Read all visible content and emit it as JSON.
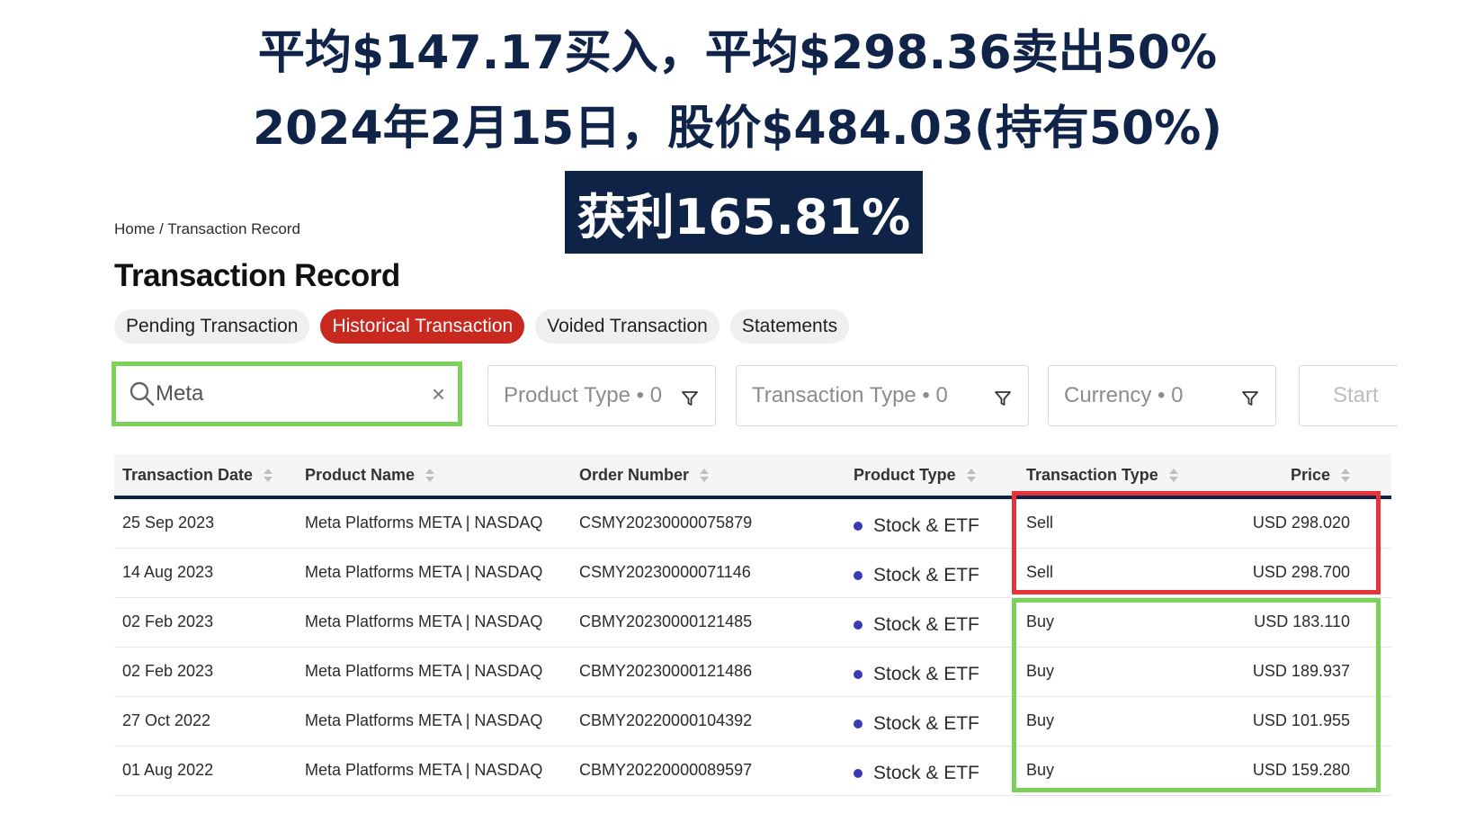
{
  "headline": {
    "line1": "平均$147.17买入，平均$298.36卖出50%",
    "line2": "2024年2月15日，股价$484.03(持有50%)",
    "profit": "获利165.81%"
  },
  "breadcrumb": "Home / Transaction Record",
  "page_title": "Transaction Record",
  "tabs": [
    {
      "label": "Pending Transaction",
      "active": false
    },
    {
      "label": "Historical Transaction",
      "active": true
    },
    {
      "label": "Voided Transaction",
      "active": false
    },
    {
      "label": "Statements",
      "active": false
    }
  ],
  "search": {
    "value": "Meta",
    "clear_symbol": "×"
  },
  "filters": {
    "product_type": "Product Type • 0",
    "transaction_type": "Transaction Type • 0",
    "currency": "Currency • 0",
    "start": "Start"
  },
  "table": {
    "headers": {
      "date": "Transaction Date",
      "product_name": "Product Name",
      "order_number": "Order Number",
      "product_type": "Product Type",
      "transaction_type": "Transaction Type",
      "price": "Price"
    },
    "rows": [
      {
        "date": "25 Sep 2023",
        "name": "Meta Platforms META | NASDAQ",
        "order": "CSMY20230000075879",
        "ptype": "Stock & ETF",
        "ttype": "Sell",
        "price": "USD 298.020"
      },
      {
        "date": "14 Aug 2023",
        "name": "Meta Platforms META | NASDAQ",
        "order": "CSMY20230000071146",
        "ptype": "Stock & ETF",
        "ttype": "Sell",
        "price": "USD 298.700"
      },
      {
        "date": "02 Feb 2023",
        "name": "Meta Platforms META | NASDAQ",
        "order": "CBMY20230000121485",
        "ptype": "Stock & ETF",
        "ttype": "Buy",
        "price": "USD 183.110"
      },
      {
        "date": "02 Feb 2023",
        "name": "Meta Platforms META | NASDAQ",
        "order": "CBMY20230000121486",
        "ptype": "Stock & ETF",
        "ttype": "Buy",
        "price": "USD 189.937"
      },
      {
        "date": "27 Oct 2022",
        "name": "Meta Platforms META | NASDAQ",
        "order": "CBMY20220000104392",
        "ptype": "Stock & ETF",
        "ttype": "Buy",
        "price": "USD 101.955"
      },
      {
        "date": "01 Aug 2022",
        "name": "Meta Platforms META | NASDAQ",
        "order": "CBMY20220000089597",
        "ptype": "Stock & ETF",
        "ttype": "Buy",
        "price": "USD 159.280"
      }
    ]
  },
  "colors": {
    "headline": "#10244a",
    "active_tab": "#c8281e",
    "sell_highlight": "#e8333a",
    "buy_highlight": "#7bd15a",
    "dot": "#3a3ab8"
  }
}
